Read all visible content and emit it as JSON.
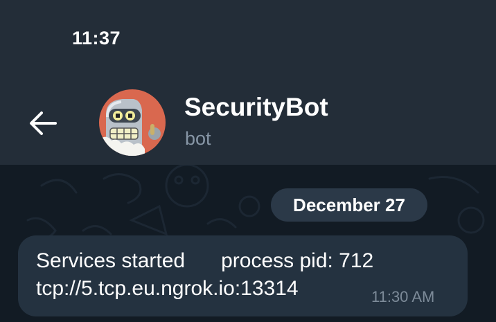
{
  "status_bar": {
    "time": "11:37"
  },
  "header": {
    "back_icon": "arrow-left-icon",
    "avatar": "bot-avatar",
    "title": "SecurityBot",
    "subtitle": "bot"
  },
  "chat": {
    "date_separator": "December 27",
    "messages": [
      {
        "text_part_1": "Services started",
        "text_part_2": "process pid: 712",
        "text_line_2": "tcp://5.tcp.eu.ngrok.io:13314",
        "time": "11:30 AM"
      }
    ]
  },
  "colors": {
    "header_bg": "#232d38",
    "chat_bg": "#121b24",
    "bubble_bg": "#243240",
    "date_chip_bg": "#2b3948",
    "subtitle": "#8796a6",
    "avatar_bg": "#d9684f"
  }
}
